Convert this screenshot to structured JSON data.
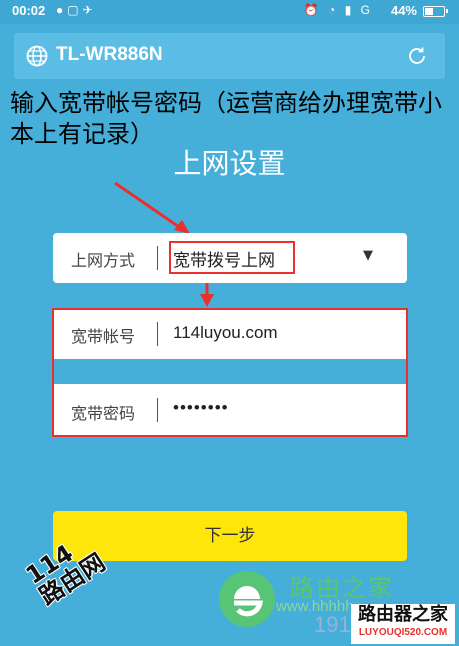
{
  "status_bar": {
    "time": "00:02",
    "battery": "44%",
    "battery_level": 0.44
  },
  "url_bar": {
    "host": "TL-WR886N",
    "icon": "globe-icon",
    "reload_icon": "reload-icon"
  },
  "annotation": {
    "text": "输入宽带帐号密码（运营商给办理宽带小本上有记录）",
    "color": "#e8312c"
  },
  "page": {
    "title": "上网设置"
  },
  "form": {
    "connection_type_label": "上网方式",
    "connection_type_value": "宽带拨号上网",
    "account_label": "宽带帐号",
    "account_value": "114luyou.com",
    "password_label": "宽带密码",
    "password_value": "••••••••"
  },
  "next_button": {
    "label": "下一步",
    "color": "#fee50a"
  },
  "watermarks": {
    "left_line1": "114",
    "left_line2": "路由网",
    "site_cn": "路由之家",
    "site_url": "www.hhhhh",
    "site_num": "191",
    "corner_cn": "路由器之家",
    "corner_url": "LUYOUQI520.COM"
  }
}
